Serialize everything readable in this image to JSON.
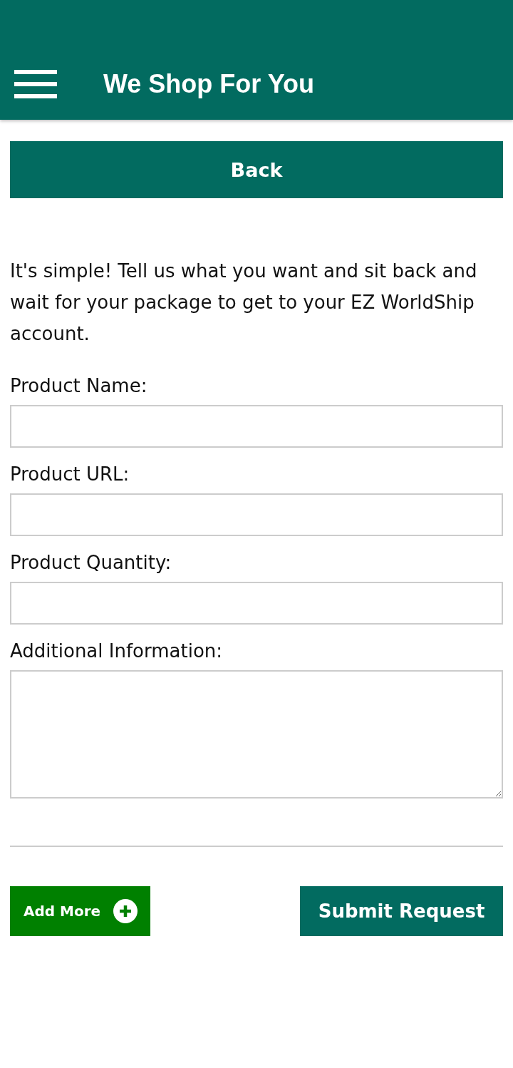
{
  "app_bar": {
    "title": "We Shop For You"
  },
  "back_button": {
    "label": "Back"
  },
  "intro": "It's simple! Tell us what you want and sit back and wait for your package to get to your EZ WorldShip account.",
  "fields": [
    {
      "label": "Product Name:",
      "kind": "input"
    },
    {
      "label": "Product URL:",
      "kind": "input"
    },
    {
      "label": "Product Quantity:",
      "kind": "input"
    },
    {
      "label": "Additional Information:",
      "kind": "textarea"
    }
  ],
  "actions": [
    {
      "label": "Add More",
      "kind": "add"
    },
    {
      "label": "Submit Request",
      "kind": "submit"
    }
  ]
}
